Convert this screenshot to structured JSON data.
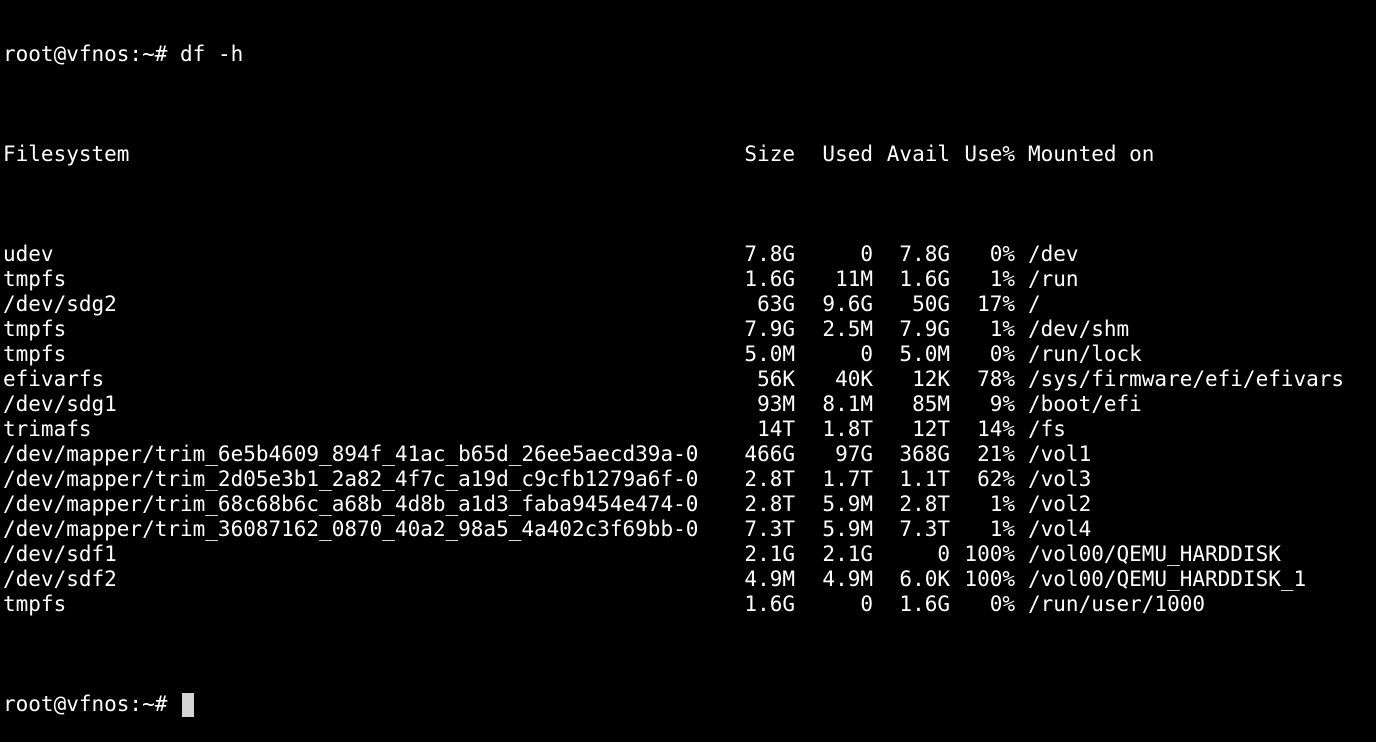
{
  "terminal": {
    "prev_prompt": "root@vfnos:~#",
    "command": "df -h",
    "headers": {
      "filesystem": "Filesystem",
      "size": "Size",
      "used": "Used",
      "avail": "Avail",
      "use": "Use%",
      "mounted": "Mounted on"
    },
    "rows": [
      {
        "fs": "udev",
        "size": "7.8G",
        "used": "0",
        "avail": "7.8G",
        "use": "0%",
        "mount": "/dev"
      },
      {
        "fs": "tmpfs",
        "size": "1.6G",
        "used": "11M",
        "avail": "1.6G",
        "use": "1%",
        "mount": "/run"
      },
      {
        "fs": "/dev/sdg2",
        "size": "63G",
        "used": "9.6G",
        "avail": "50G",
        "use": "17%",
        "mount": "/"
      },
      {
        "fs": "tmpfs",
        "size": "7.9G",
        "used": "2.5M",
        "avail": "7.9G",
        "use": "1%",
        "mount": "/dev/shm"
      },
      {
        "fs": "tmpfs",
        "size": "5.0M",
        "used": "0",
        "avail": "5.0M",
        "use": "0%",
        "mount": "/run/lock"
      },
      {
        "fs": "efivarfs",
        "size": "56K",
        "used": "40K",
        "avail": "12K",
        "use": "78%",
        "mount": "/sys/firmware/efi/efivars"
      },
      {
        "fs": "/dev/sdg1",
        "size": "93M",
        "used": "8.1M",
        "avail": "85M",
        "use": "9%",
        "mount": "/boot/efi"
      },
      {
        "fs": "trimafs",
        "size": "14T",
        "used": "1.8T",
        "avail": "12T",
        "use": "14%",
        "mount": "/fs"
      },
      {
        "fs": "/dev/mapper/trim_6e5b4609_894f_41ac_b65d_26ee5aecd39a-0",
        "size": "466G",
        "used": "97G",
        "avail": "368G",
        "use": "21%",
        "mount": "/vol1"
      },
      {
        "fs": "/dev/mapper/trim_2d05e3b1_2a82_4f7c_a19d_c9cfb1279a6f-0",
        "size": "2.8T",
        "used": "1.7T",
        "avail": "1.1T",
        "use": "62%",
        "mount": "/vol3"
      },
      {
        "fs": "/dev/mapper/trim_68c68b6c_a68b_4d8b_a1d3_faba9454e474-0",
        "size": "2.8T",
        "used": "5.9M",
        "avail": "2.8T",
        "use": "1%",
        "mount": "/vol2"
      },
      {
        "fs": "/dev/mapper/trim_36087162_0870_40a2_98a5_4a402c3f69bb-0",
        "size": "7.3T",
        "used": "5.9M",
        "avail": "7.3T",
        "use": "1%",
        "mount": "/vol4"
      },
      {
        "fs": "/dev/sdf1",
        "size": "2.1G",
        "used": "2.1G",
        "avail": "0",
        "use": "100%",
        "mount": "/vol00/QEMU_HARDDISK"
      },
      {
        "fs": "/dev/sdf2",
        "size": "4.9M",
        "used": "4.9M",
        "avail": "6.0K",
        "use": "100%",
        "mount": "/vol00/QEMU_HARDDISK_1"
      },
      {
        "fs": "tmpfs",
        "size": "1.6G",
        "used": "0",
        "avail": "1.6G",
        "use": "0%",
        "mount": "/run/user/1000"
      }
    ],
    "current_prompt": "root@vfnos:~#"
  }
}
